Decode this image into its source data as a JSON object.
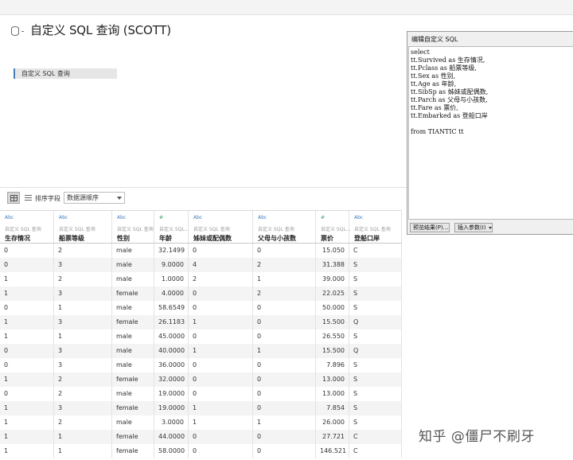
{
  "page": {
    "title": "自定义 SQL 查询 (SCOTT)",
    "tag_label": "自定义 SQL 查询"
  },
  "toolbar": {
    "grid_view_icon": "grid-icon",
    "list_view_icon": "list-icon",
    "sort_label": "排序字段",
    "sort_value": "数据源顺序"
  },
  "table": {
    "columns": [
      {
        "type": "Abc",
        "source": "自定义 SQL 查询",
        "name": "生存情况"
      },
      {
        "type": "Abc",
        "source": "自定义 SQL 查询",
        "name": "船票等级"
      },
      {
        "type": "Abc",
        "source": "自定义 SQL 查询",
        "name": "性别"
      },
      {
        "type": "#",
        "source": "自定义 SQL...",
        "name": "年龄"
      },
      {
        "type": "Abc",
        "source": "自定义 SQL 查询",
        "name": "姊妹或配偶数"
      },
      {
        "type": "Abc",
        "source": "自定义 SQL 查询",
        "name": "父母与小孩数"
      },
      {
        "type": "#",
        "source": "自定义 SQL...",
        "name": "票价"
      },
      {
        "type": "Abc",
        "source": "自定义 SQL 查询",
        "name": "登船口岸"
      }
    ],
    "rows": [
      [
        "0",
        "2",
        "male",
        "32.1499",
        "0",
        "0",
        "15.050",
        "C"
      ],
      [
        "0",
        "3",
        "male",
        "9.0000",
        "4",
        "2",
        "31.388",
        "S"
      ],
      [
        "1",
        "2",
        "male",
        "1.0000",
        "2",
        "1",
        "39.000",
        "S"
      ],
      [
        "1",
        "3",
        "female",
        "4.0000",
        "0",
        "2",
        "22.025",
        "S"
      ],
      [
        "0",
        "1",
        "male",
        "58.6549",
        "0",
        "0",
        "50.000",
        "S"
      ],
      [
        "1",
        "3",
        "female",
        "26.1183",
        "1",
        "0",
        "15.500",
        "Q"
      ],
      [
        "1",
        "1",
        "male",
        "45.0000",
        "0",
        "0",
        "26.550",
        "S"
      ],
      [
        "0",
        "3",
        "male",
        "40.0000",
        "1",
        "1",
        "15.500",
        "Q"
      ],
      [
        "0",
        "3",
        "male",
        "36.0000",
        "0",
        "0",
        "7.896",
        "S"
      ],
      [
        "1",
        "2",
        "female",
        "32.0000",
        "0",
        "0",
        "13.000",
        "S"
      ],
      [
        "0",
        "2",
        "male",
        "19.0000",
        "0",
        "0",
        "13.000",
        "S"
      ],
      [
        "1",
        "3",
        "female",
        "19.0000",
        "1",
        "0",
        "7.854",
        "S"
      ],
      [
        "1",
        "2",
        "male",
        "3.0000",
        "1",
        "1",
        "26.000",
        "S"
      ],
      [
        "1",
        "1",
        "female",
        "44.0000",
        "0",
        "0",
        "27.721",
        "C"
      ],
      [
        "1",
        "1",
        "female",
        "58.0000",
        "0",
        "0",
        "146.521",
        "C"
      ]
    ]
  },
  "dialog": {
    "title": "编辑自定义 SQL",
    "sql": "select\ntt.Survived as 生存情况,\ntt.Pclass as 船票等级,\ntt.Sex as 性别,\ntt.Age as 年龄,\ntt.SibSp as 姊妹或配偶数,\ntt.Parch as 父母与小孩数,\ntt.Fare as 票价,\ntt.Embarked as 登船口岸\n\nfrom TIANTIC tt",
    "preview_label": "预览结果(P)...",
    "insert_param_label": "插入参数(I)"
  },
  "watermark": "知乎 @僵尸不刷牙"
}
